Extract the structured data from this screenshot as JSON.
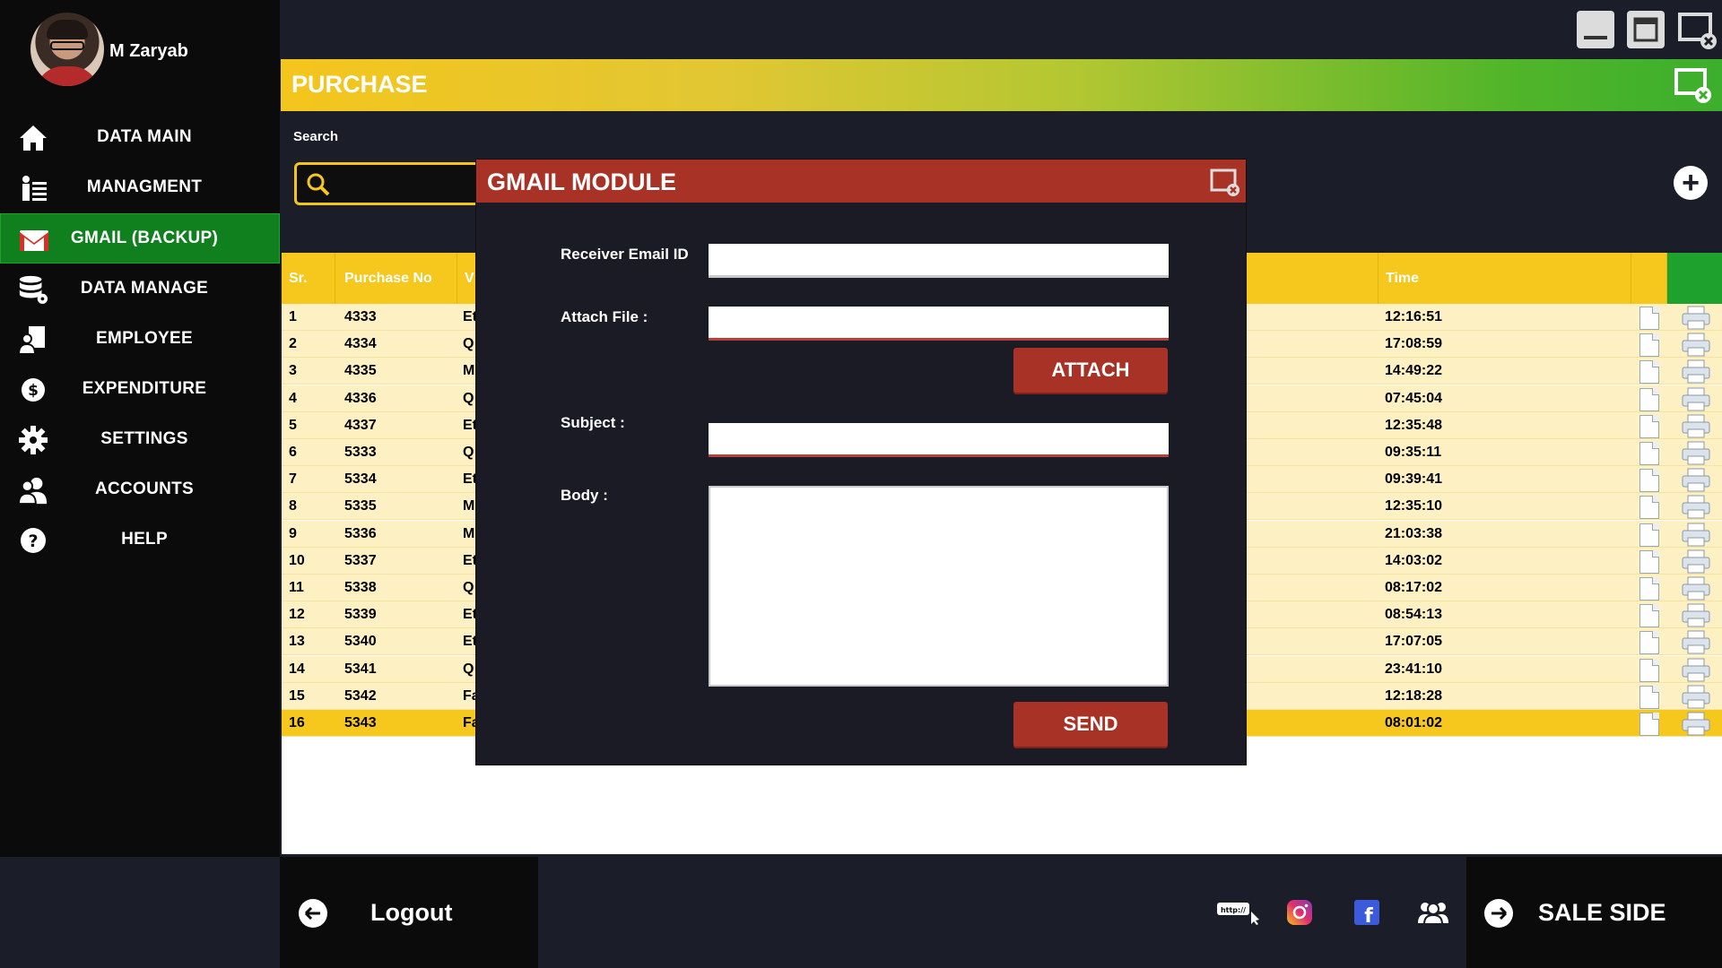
{
  "user": {
    "name": "M Zaryab"
  },
  "nav": [
    {
      "label": "DATA MAIN",
      "icon": "home-icon"
    },
    {
      "label": "MANAGMENT",
      "icon": "management-icon"
    },
    {
      "label": "GMAIL (BACKUP)",
      "icon": "gmail-icon",
      "active": true
    },
    {
      "label": "DATA MANAGE",
      "icon": "database-icon"
    },
    {
      "label": "EMPLOYEE",
      "icon": "employee-icon"
    },
    {
      "label": "EXPENDITURE",
      "icon": "dollar-icon"
    },
    {
      "label": "SETTINGS",
      "icon": "gear-icon"
    },
    {
      "label": "ACCOUNTS",
      "icon": "accounts-icon"
    },
    {
      "label": "HELP",
      "icon": "help-icon"
    }
  ],
  "header": {
    "title": "PURCHASE"
  },
  "search": {
    "label": "Search",
    "placeholder": ""
  },
  "table": {
    "columns": [
      "Sr.",
      "Purchase No",
      "V",
      "Time"
    ],
    "rows": [
      {
        "sr": "1",
        "purchase_no": "4333",
        "v": "Et",
        "time": "12:16:51"
      },
      {
        "sr": "2",
        "purchase_no": "4334",
        "v": "Q",
        "time": "17:08:59"
      },
      {
        "sr": "3",
        "purchase_no": "4335",
        "v": "M",
        "time": "14:49:22"
      },
      {
        "sr": "4",
        "purchase_no": "4336",
        "v": "Q",
        "time": "07:45:04"
      },
      {
        "sr": "5",
        "purchase_no": "4337",
        "v": "Et",
        "time": "12:35:48"
      },
      {
        "sr": "6",
        "purchase_no": "5333",
        "v": "Q",
        "time": "09:35:11"
      },
      {
        "sr": "7",
        "purchase_no": "5334",
        "v": "Et",
        "time": "09:39:41"
      },
      {
        "sr": "8",
        "purchase_no": "5335",
        "v": "M",
        "time": "12:35:10"
      },
      {
        "sr": "9",
        "purchase_no": "5336",
        "v": "M",
        "time": "21:03:38"
      },
      {
        "sr": "10",
        "purchase_no": "5337",
        "v": "Et",
        "time": "14:03:02"
      },
      {
        "sr": "11",
        "purchase_no": "5338",
        "v": "Q",
        "time": "08:17:02"
      },
      {
        "sr": "12",
        "purchase_no": "5339",
        "v": "Et",
        "time": "08:54:13"
      },
      {
        "sr": "13",
        "purchase_no": "5340",
        "v": "Et",
        "time": "17:07:05"
      },
      {
        "sr": "14",
        "purchase_no": "5341",
        "v": "Q",
        "time": "23:41:10"
      },
      {
        "sr": "15",
        "purchase_no": "5342",
        "v": "Fa",
        "time": "12:18:28"
      },
      {
        "sr": "16",
        "purchase_no": "5343",
        "v": "Fa",
        "time": "08:01:02",
        "selected": true
      }
    ]
  },
  "modal": {
    "title": "GMAIL MODULE",
    "receiver_label": "Receiver Email ID",
    "receiver_value": "",
    "attach_label": "Attach File :",
    "attach_value": "",
    "attach_button": "ATTACH",
    "subject_label": "Subject :",
    "subject_value": "",
    "body_label": "Body :",
    "body_value": "",
    "send_button": "SEND"
  },
  "footer": {
    "logout_label": "Logout",
    "sale_label": "SALE SIDE",
    "social_icons": [
      "web-link-icon",
      "instagram-icon",
      "facebook-icon",
      "group-icon"
    ]
  },
  "colors": {
    "sidebar_bg": "#0b0b0b",
    "active_nav": "#10801e",
    "accent_yellow": "#f6c71d",
    "modal_red": "#a93226",
    "row_bg": "#fdf0c3"
  }
}
